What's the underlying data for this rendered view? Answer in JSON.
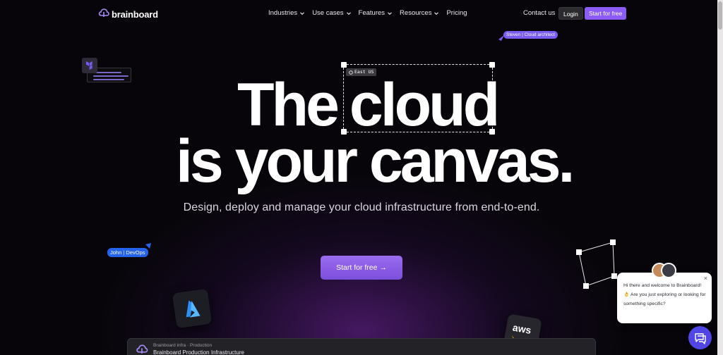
{
  "nav": {
    "brand": "brainboard",
    "menu": [
      {
        "label": "Industries",
        "has_dropdown": true
      },
      {
        "label": "Use cases",
        "has_dropdown": true
      },
      {
        "label": "Features",
        "has_dropdown": true
      },
      {
        "label": "Resources",
        "has_dropdown": true
      },
      {
        "label": "Pricing",
        "has_dropdown": false
      }
    ],
    "contact": "Contact us",
    "login": "Login",
    "cta": "Start for free"
  },
  "hero": {
    "line1_word1": "The",
    "line1_word2": "cloud",
    "line2": "is your canvas.",
    "subtitle": "Design, deploy and manage your cloud infrastructure from end-to-end.",
    "cta": "Start for free →",
    "region_tag": "East US"
  },
  "cursors": {
    "steven": {
      "name": "Steven",
      "role": "Cloud architect",
      "color": "#7b5cf2"
    },
    "john": {
      "name": "John",
      "role": "DevOps",
      "color": "#2563eb"
    }
  },
  "icons": {
    "brand": "brainboard-cloud-icon",
    "terraform": "terraform-icon",
    "azure": "azure-icon",
    "aws": "aws-logo-icon"
  },
  "tiles": {
    "aws_label": "aws"
  },
  "panel": {
    "breadcrumb": "Brainboard infra · Production",
    "title": "Brainboard Production Infrastructure"
  },
  "chat": {
    "message": "Hi there and welcome to Brainboard! 👌 Are you just exploring or looking for something specific?",
    "close": "×"
  },
  "colors": {
    "background": "#070509",
    "accent": "#8b5cf6",
    "glow": "#7828aa",
    "chat_launcher": "#4f46e5"
  }
}
